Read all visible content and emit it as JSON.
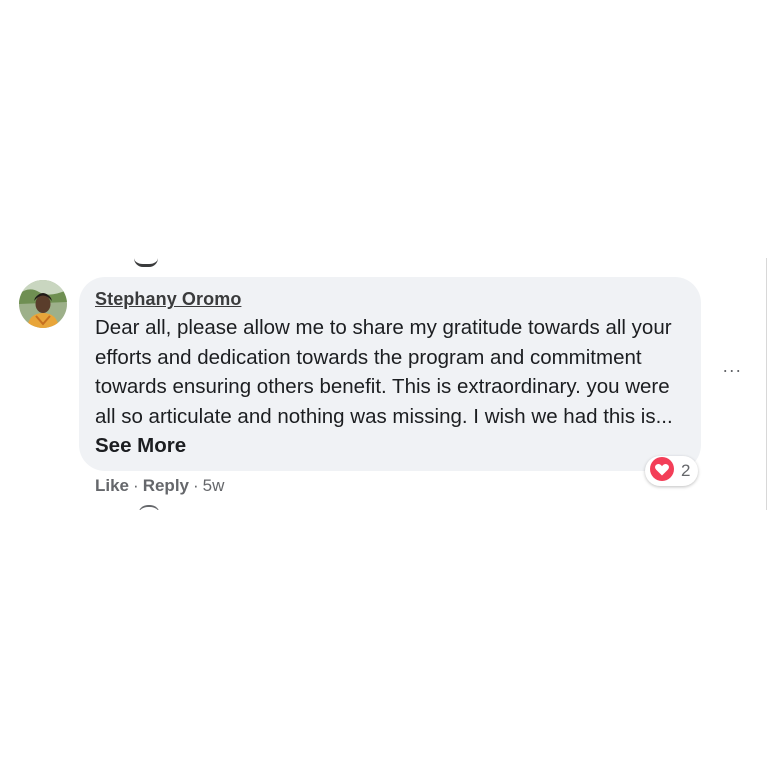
{
  "comment": {
    "author": "Stephany Oromo",
    "text": "Dear all, please allow me to share my gratitude towards all your efforts and dedication towards the program and commitment towards ensuring others benefit. This is extraordinary. you were all so articulate and nothing was missing. I wish we had this is...",
    "see_more_label": "See More",
    "reaction_count": "2",
    "reaction_icon": "love-reaction-icon",
    "actions": {
      "like_label": "Like",
      "reply_label": "Reply",
      "separator": "·",
      "timestamp": "5w"
    },
    "more_options_label": "···"
  },
  "colors": {
    "bubble_background": "#f0f2f5",
    "love_reaction": "#f33e58",
    "secondary_text": "#65676b",
    "primary_text": "#1c1e21"
  }
}
